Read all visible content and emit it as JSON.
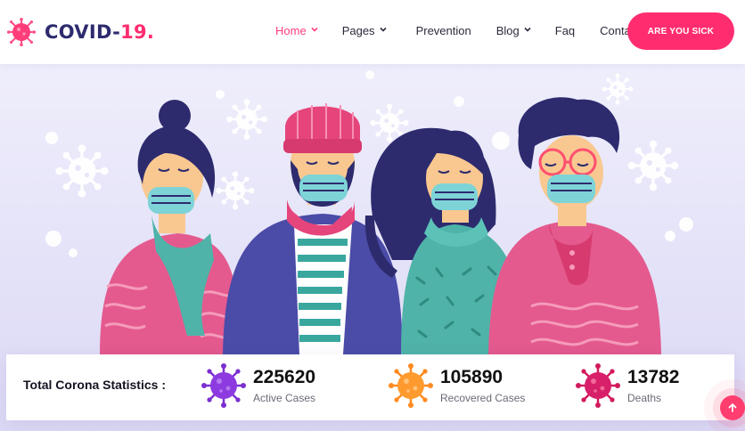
{
  "brand": {
    "name": "COVID-",
    "accent": "19.",
    "primary_color": "#2d2a6e",
    "accent_color": "#ff2d6f"
  },
  "nav": {
    "items": [
      {
        "label": "Home",
        "has_dropdown": true,
        "active": true
      },
      {
        "label": "Pages",
        "has_dropdown": true
      },
      {
        "label": "Prevention",
        "has_dropdown": false
      },
      {
        "label": "Blog",
        "has_dropdown": true
      },
      {
        "label": "Faq",
        "has_dropdown": false
      },
      {
        "label": "Contact",
        "has_dropdown": false
      }
    ],
    "cta_label": "ARE YOU SICK"
  },
  "hero": {
    "illustration": "people-wearing-masks",
    "background_color": "#e6e4f8"
  },
  "stats": {
    "title": "Total Corona Statistics :",
    "items": [
      {
        "value": "225620",
        "label": "Active Cases",
        "icon": "virus-icon",
        "color": "#7b2fd0"
      },
      {
        "value": "105890",
        "label": "Recovered Cases",
        "icon": "virus-icon",
        "color": "#ff8a1f"
      },
      {
        "value": "13782",
        "label": "Deaths",
        "icon": "virus-icon",
        "color": "#d21a5c"
      }
    ]
  },
  "scroll_top": {
    "icon": "arrow-up-icon"
  }
}
